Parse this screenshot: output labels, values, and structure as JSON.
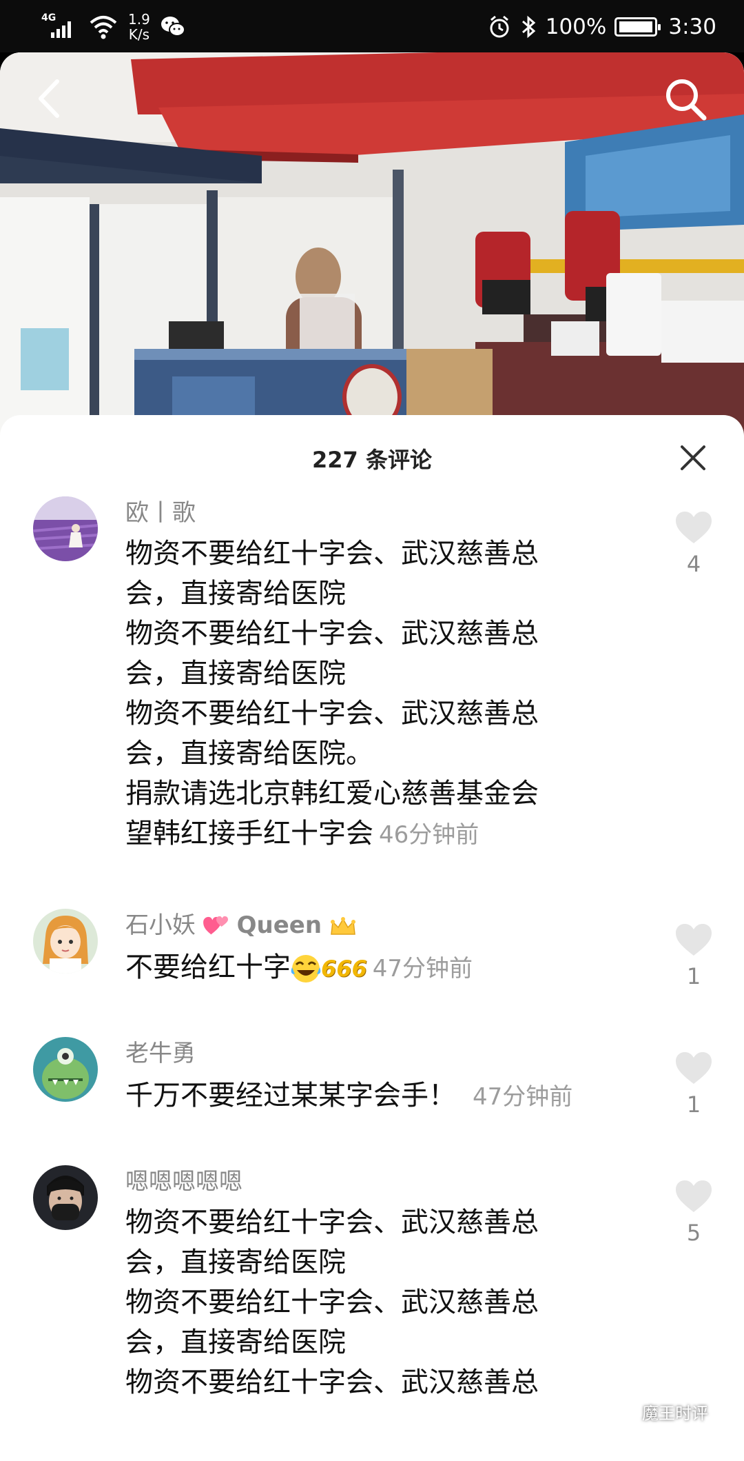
{
  "status_bar": {
    "network": "4G",
    "speed_value": "1.9",
    "speed_unit": "K/s",
    "battery": "100%",
    "time": "3:30"
  },
  "video": {
    "icons": {
      "back": "back-arrow-icon",
      "search": "search-icon"
    }
  },
  "comments_panel": {
    "title": "227 条评论",
    "close_icon": "close-icon",
    "comments": [
      {
        "user": "欧丨歌",
        "lines": [
          "物资不要给红十字会、武汉慈善总",
          "会，直接寄给医院",
          "物资不要给红十字会、武汉慈善总",
          "会，直接寄给医院",
          "物资不要给红十字会、武汉慈善总",
          "会，直接寄给医院。",
          "捐款请选北京韩红爱心慈善基金会",
          "望韩红接手红十字会"
        ],
        "time": "46分钟前",
        "likes": "4"
      },
      {
        "user_name": "石小妖",
        "user_suffix": "Queen",
        "text": "不要给红十字",
        "emoji_text": "666",
        "time": "47分钟前",
        "likes": "1"
      },
      {
        "user": "老牛勇",
        "text": "千万不要经过某某字会手！",
        "time": "47分钟前",
        "likes": "1"
      },
      {
        "user": "嗯嗯嗯嗯嗯",
        "lines": [
          "物资不要给红十字会、武汉慈善总",
          "会，直接寄给医院",
          "物资不要给红十字会、武汉慈善总",
          "会，直接寄给医院",
          "物资不要给红十字会、武汉慈善总"
        ],
        "likes": "5"
      }
    ]
  },
  "watermark": "魔王时评",
  "colors": {
    "sheet_bg": "#ffffff",
    "username": "#888888",
    "timestamp": "#9c9c9c",
    "heart": "#e5e5e5"
  }
}
